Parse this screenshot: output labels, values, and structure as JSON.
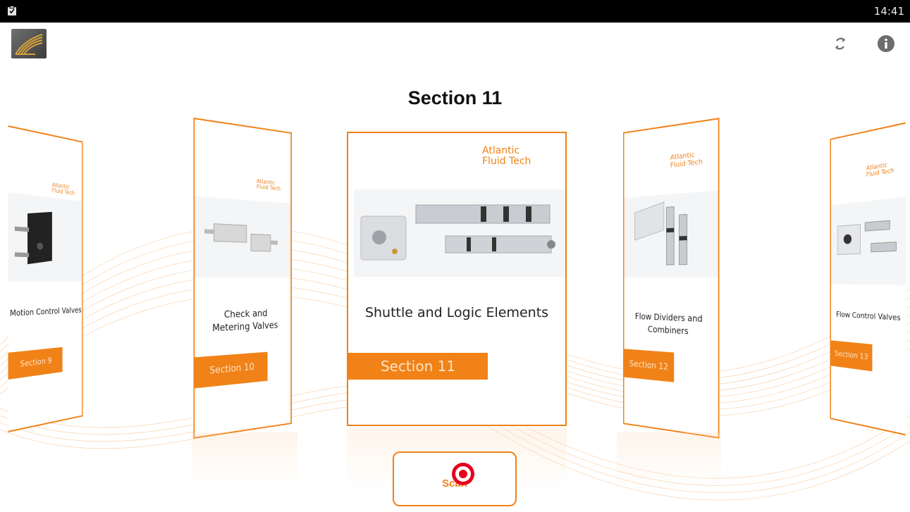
{
  "status_bar": {
    "time": "14:41"
  },
  "header": {
    "title": "Section 11"
  },
  "cards": [
    {
      "brand_line1": "Atlantic",
      "brand_line2": "Fluid Tech",
      "name": "Motion Control Valves",
      "section": "Section 9"
    },
    {
      "brand_line1": "Atlantic",
      "brand_line2": "Fluid Tech",
      "name": "Check and Metering Valves",
      "section": "Section 10"
    },
    {
      "brand_line1": "Atlantic",
      "brand_line2": "Fluid Tech",
      "name": "Shuttle and Logic Elements",
      "section": "Section 11"
    },
    {
      "brand_line1": "Atlantic",
      "brand_line2": "Fluid Tech",
      "name": "Flow Dividers and Combiners",
      "section": "Section 12"
    },
    {
      "brand_line1": "Atlantic",
      "brand_line2": "Fluid Tech",
      "name": "Flow Control Valves",
      "section": "Section 13"
    }
  ],
  "scan_button": {
    "label": "Scan"
  },
  "icons": {
    "status": "clipboard-check-icon",
    "app_logo": "atlantic-fluid-tech-logo",
    "sync": "sync-icon",
    "info": "info-icon"
  },
  "colors": {
    "accent": "#f08218",
    "status_bar": "#000000",
    "marker": "#e5001b"
  }
}
